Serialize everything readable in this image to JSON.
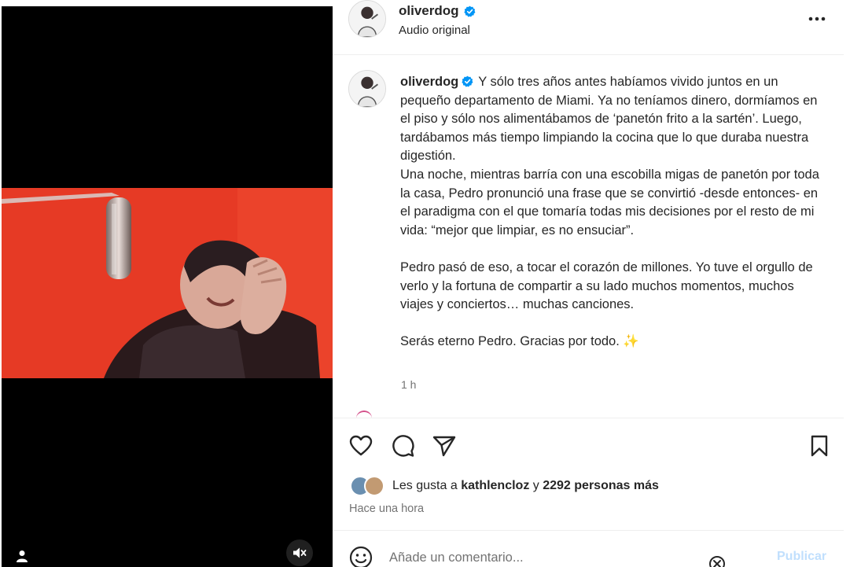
{
  "post": {
    "username": "oliverdog",
    "audio_label": "Audio original",
    "verified": true
  },
  "caption": {
    "username": "oliverdog",
    "text": "Y sólo tres años antes habíamos vivido juntos en un pequeño departamento de Miami. Ya no teníamos dinero, dormíamos en el piso y sólo nos alimentábamos de ‘panetón frito a la sartén’. Luego, tardábamos más tiempo limpiando la cocina que lo que duraba nuestra digestión.\nUna noche, mientras barría con una escobilla migas de panetón por toda la casa, Pedro pronunció una frase que se convirtió -desde entonces- en el paradigma con el que tomaría todas mis decisiones por el resto de mi vida: “mejor que limpiar, es no ensuciar”.\n\nPedro pasó de eso, a tocar el corazón de millones. Yo tuve el orgullo de verlo y la fortuna de compartir a su lado muchos momentos, muchos viajes y conciertos… muchas canciones.\n\nSerás eterno Pedro. Gracias por todo. ✨",
    "time": "1 h"
  },
  "likes": {
    "prefix": "Les gusta a",
    "user": "kathlencloz",
    "connector": "y",
    "others": "2292 personas más"
  },
  "posted_ago": "Hace una hora",
  "comment_box": {
    "placeholder": "Añade un comentario...",
    "publish_label": "Publicar"
  },
  "colors": {
    "verified_blue": "#0095f6",
    "publish_disabled": "#c0dffd",
    "video_red": "#e8321f"
  },
  "icons": [
    "user-tag-icon",
    "mute-icon",
    "more-options-icon",
    "heart-icon",
    "comment-icon",
    "share-icon",
    "bookmark-icon",
    "emoji-icon",
    "close-icon",
    "verified-icon"
  ]
}
